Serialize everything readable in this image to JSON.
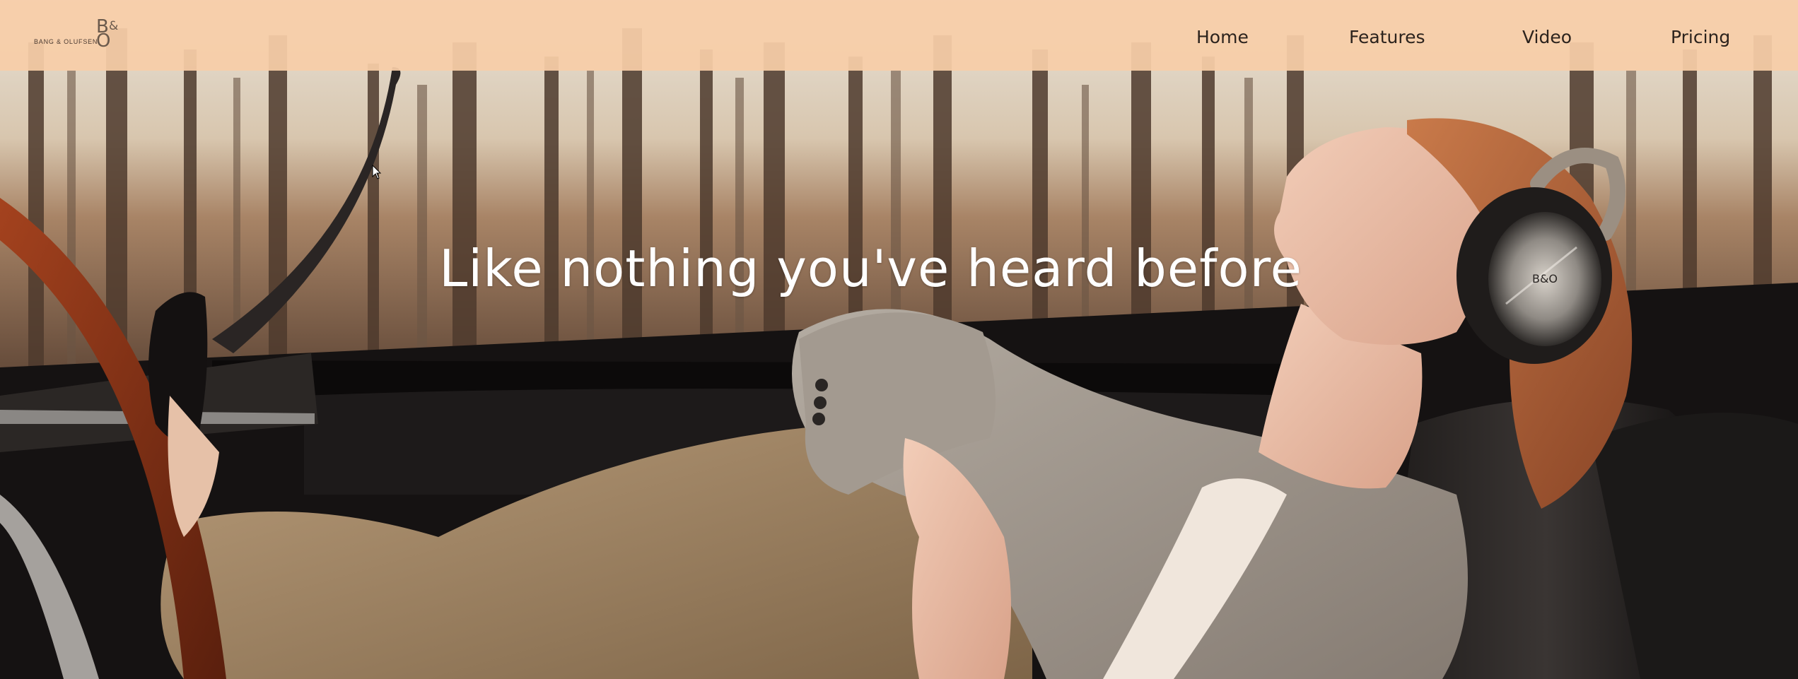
{
  "brand": {
    "name": "BANG & OLUFSEN",
    "mark_top": "B",
    "mark_amp": "&",
    "mark_bottom": "O"
  },
  "nav": {
    "items": [
      {
        "label": "Home"
      },
      {
        "label": "Features"
      },
      {
        "label": "Video"
      },
      {
        "label": "Pricing"
      }
    ]
  },
  "hero": {
    "headline": "Like nothing you've heard before",
    "image": "woman-with-headphones-in-car"
  },
  "headphones_badge": "B&O",
  "colors": {
    "header_bg": "#f8cda8",
    "nav_text": "#2c231d",
    "headline_text": "#ffffff"
  }
}
